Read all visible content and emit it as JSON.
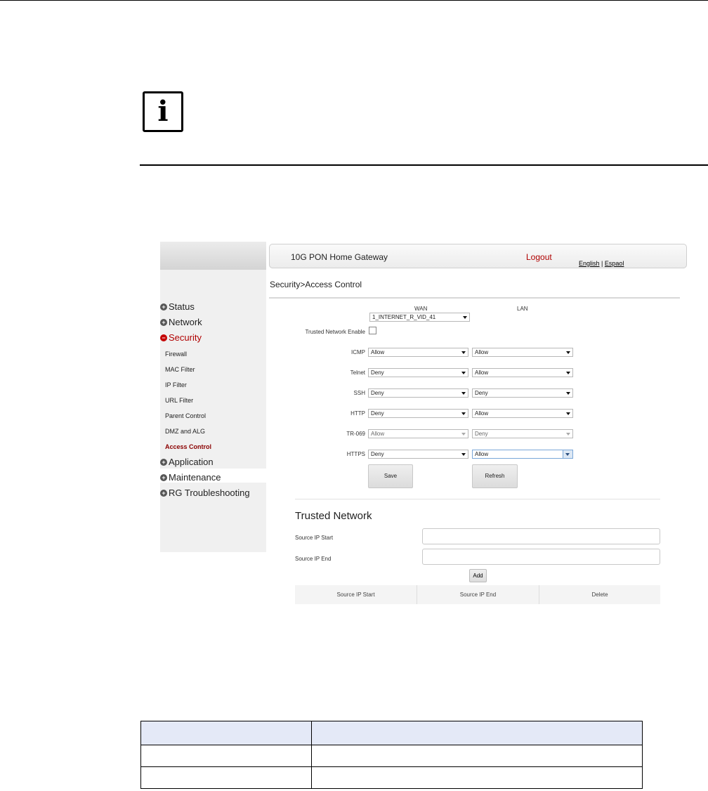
{
  "note": {
    "icon": "info-icon",
    "glyph": "i"
  },
  "header": {
    "title": "10G PON Home Gateway",
    "logout": "Logout",
    "lang_english": "English",
    "lang_sep": " | ",
    "lang_spanish": "Espaol"
  },
  "breadcrumb": "Security>Access Control",
  "sidebar": {
    "items": [
      {
        "label": "Status",
        "expanded": false
      },
      {
        "label": "Network",
        "expanded": false
      },
      {
        "label": "Security",
        "expanded": true
      },
      {
        "label": "Application",
        "expanded": false
      },
      {
        "label": "Maintenance",
        "expanded": false
      },
      {
        "label": "RG Troubleshooting",
        "expanded": false
      }
    ],
    "security_sub": [
      "Firewall",
      "MAC Filter",
      "IP Filter",
      "URL Filter",
      "Parent Control",
      "DMZ and ALG",
      "Access Control"
    ],
    "active": "Access Control"
  },
  "form": {
    "wan_header": "WAN",
    "lan_header": "LAN",
    "wan_interface": "1_INTERNET_R_VID_41",
    "trusted_label": "Trusted Network Enable",
    "trusted_checked": false,
    "services": [
      {
        "name": "ICMP",
        "wan": "Allow",
        "lan": "Allow"
      },
      {
        "name": "Telnet",
        "wan": "Deny",
        "lan": "Allow"
      },
      {
        "name": "SSH",
        "wan": "Deny",
        "lan": "Deny"
      },
      {
        "name": "HTTP",
        "wan": "Deny",
        "lan": "Allow"
      },
      {
        "name": "TR-069",
        "wan": "Allow",
        "lan": "Deny"
      },
      {
        "name": "HTTPS",
        "wan": "Deny",
        "lan": "Allow"
      }
    ],
    "save": "Save",
    "refresh": "Refresh"
  },
  "trusted": {
    "title": "Trusted Network",
    "start_label": "Source IP Start",
    "end_label": "Source IP End",
    "start_value": "",
    "end_value": "",
    "add": "Add",
    "columns": [
      "Source IP Start",
      "Source IP End",
      "Delete"
    ]
  },
  "colors": {
    "accent_red": "#b00000",
    "active_sub": "#8b0000",
    "table_header_bg": "#e4e9f7"
  }
}
